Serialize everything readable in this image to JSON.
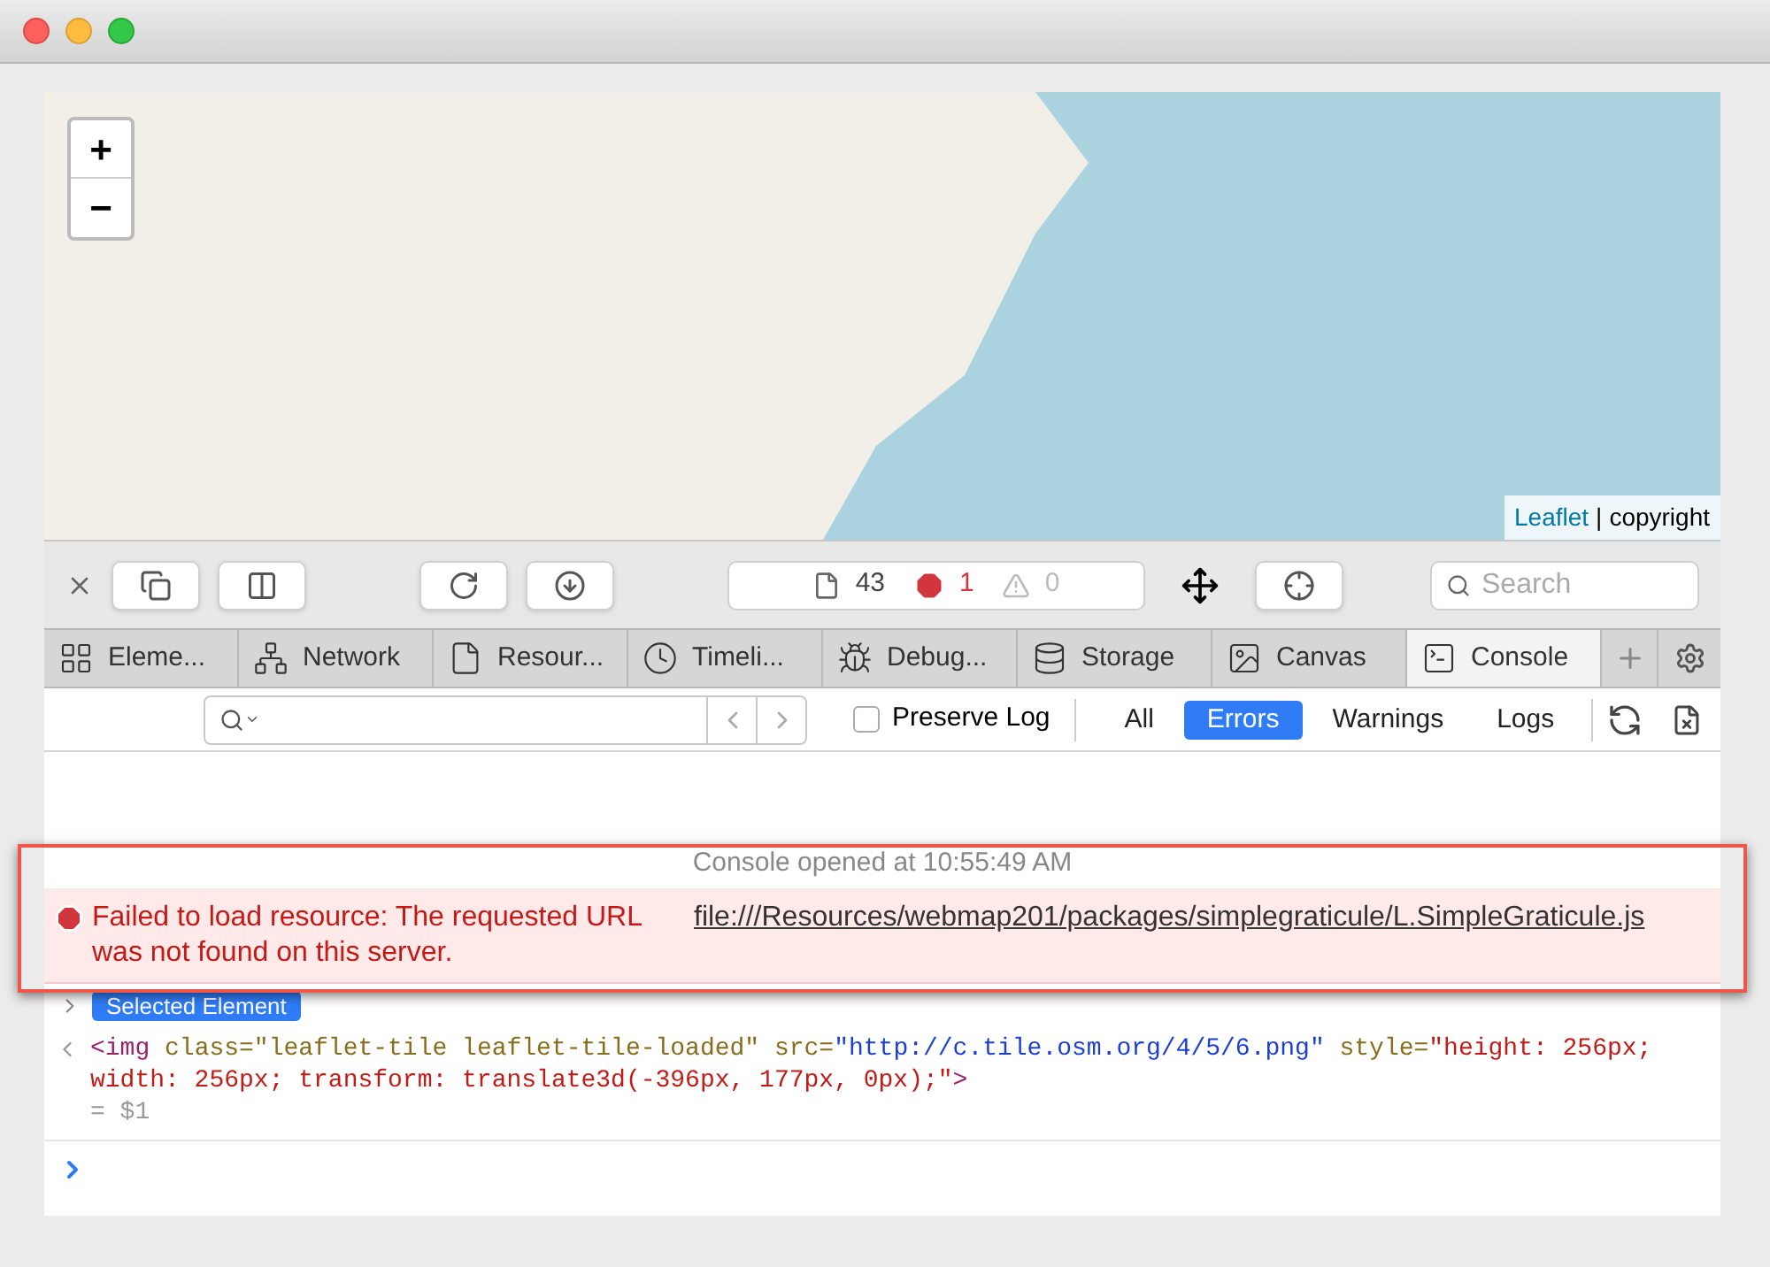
{
  "map": {
    "zoom_in": "+",
    "zoom_out": "−",
    "attribution_link": "Leaflet",
    "attribution_separator": "|",
    "attribution_text": "copyright"
  },
  "toolbar": {
    "resources_count": "43",
    "errors_count": "1",
    "warnings_count": "0",
    "search": {
      "placeholder": "Search"
    }
  },
  "tabs": [
    {
      "kind": "elements",
      "label": "Eleme...",
      "selected": false
    },
    {
      "kind": "network",
      "label": "Network",
      "selected": false
    },
    {
      "kind": "resources",
      "label": "Resour...",
      "selected": false
    },
    {
      "kind": "timeline",
      "label": "Timeli...",
      "selected": false
    },
    {
      "kind": "debugger",
      "label": "Debug...",
      "selected": false
    },
    {
      "kind": "storage",
      "label": "Storage",
      "selected": false
    },
    {
      "kind": "canvas",
      "label": "Canvas",
      "selected": false
    },
    {
      "kind": "console",
      "label": "Console",
      "selected": true
    }
  ],
  "filter_bar": {
    "preserve_log": {
      "label": "Preserve Log",
      "checked": false
    },
    "filters": [
      {
        "label": "All",
        "selected": false
      },
      {
        "label": "Errors",
        "selected": true
      },
      {
        "label": "Warnings",
        "selected": false
      },
      {
        "label": "Logs",
        "selected": false
      }
    ]
  },
  "console": {
    "opened": "Console opened at 10:55:49 AM",
    "error": {
      "message": "Failed to load resource: The requested URL was not found on this server.",
      "link": "file:///Resources/webmap201/packages/simplegraticule/L.SimpleGraticule.js"
    },
    "selected_badge": "Selected Element",
    "output": [
      {
        "kind": "tag",
        "text": "<img"
      },
      {
        "kind": "attr",
        "text": " class=\"leaflet-tile leaflet-tile-loaded\""
      },
      {
        "kind": "attr",
        "text": " src="
      },
      {
        "kind": "link",
        "text": "\"http://c.tile.osm.org/4/5/6.png\""
      },
      {
        "kind": "attr",
        "text": " style="
      },
      {
        "kind": "value",
        "text": "\"height: 256px; width: 256px; transform: translate3d(-396px, 177px, 0px);\""
      },
      {
        "kind": "tag",
        "text": ">"
      }
    ],
    "result": "= $1"
  }
}
